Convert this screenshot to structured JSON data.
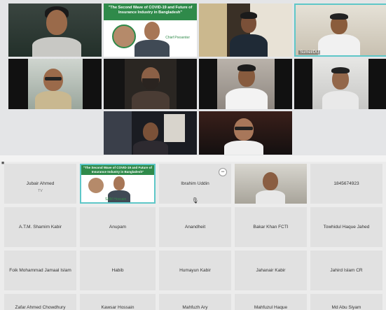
{
  "slide": {
    "title": "\"The Second Wave of COVID-19 and Future of Insurance Industry in Bangladesh\"",
    "subtitle": "Chief Presenter"
  },
  "gallery_tiles": [
    {
      "name": "tile-participant-1"
    },
    {
      "name": "tile-presentation"
    },
    {
      "name": "tile-participant-3"
    },
    {
      "name": "tile-participant-4",
      "caption": "Sumel/DU"
    },
    {
      "name": "tile-participant-5"
    },
    {
      "name": "tile-participant-6"
    },
    {
      "name": "tile-participant-7"
    },
    {
      "name": "tile-participant-8"
    },
    {
      "name": "tile-participant-9"
    },
    {
      "name": "tile-participant-10"
    }
  ],
  "participants": {
    "r0": [
      "Jubair Ahmed",
      "",
      "Ibrahim Uddin",
      "",
      "1845674923"
    ],
    "r0_sub": "TV",
    "r0_slide_caption": "SAM Hossain",
    "r1": [
      "A.T.M. Shamim Kabir",
      "Anupam",
      "Anandheit",
      "Bakar Khan FCTI",
      "Towhidul Haque Jahed"
    ],
    "r2": [
      "Foik Mohammad Jamaal Islam",
      "Habib",
      "Humayun Kabir",
      "Jahanair Kabir",
      "Jahird Islam CR"
    ],
    "r3": [
      "Zafar Ahmed Chowdhury",
      "Kawsar Hossain",
      "Mahfuzh Ary",
      "Mahfuzul Haque",
      "Md Abu Siyam"
    ]
  },
  "icons": {
    "minus": "minus-icon",
    "mic": "microphone-icon",
    "camera": "camera-icon"
  },
  "colors": {
    "accent": "#5ec7c8",
    "slide_green": "#2f8a4a"
  }
}
